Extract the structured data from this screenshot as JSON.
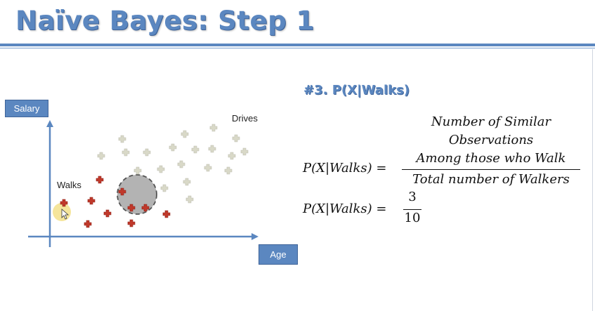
{
  "title": "Naïve Bayes: Step 1",
  "plot": {
    "y_axis_label": "Salary",
    "x_axis_label": "Age",
    "walks_label": "Walks",
    "drives_label": "Drives",
    "walk_color": "#c0392b",
    "drive_color": "#d9d9c8",
    "circle_color": "#b3b3b3",
    "highlight_color": "#f3e08a",
    "axis_color": "#5b87c0"
  },
  "section_heading": "#3. P(X|Walks)",
  "equation1": {
    "lhs": "P(X|Walks) =",
    "numerator_lines": [
      "Number of Similar",
      "Observations",
      "Among those who Walk"
    ],
    "denominator": "Total number of Walkers"
  },
  "equation2": {
    "lhs": "P(X|Walks) =",
    "numerator": "3",
    "denominator": "10"
  }
}
